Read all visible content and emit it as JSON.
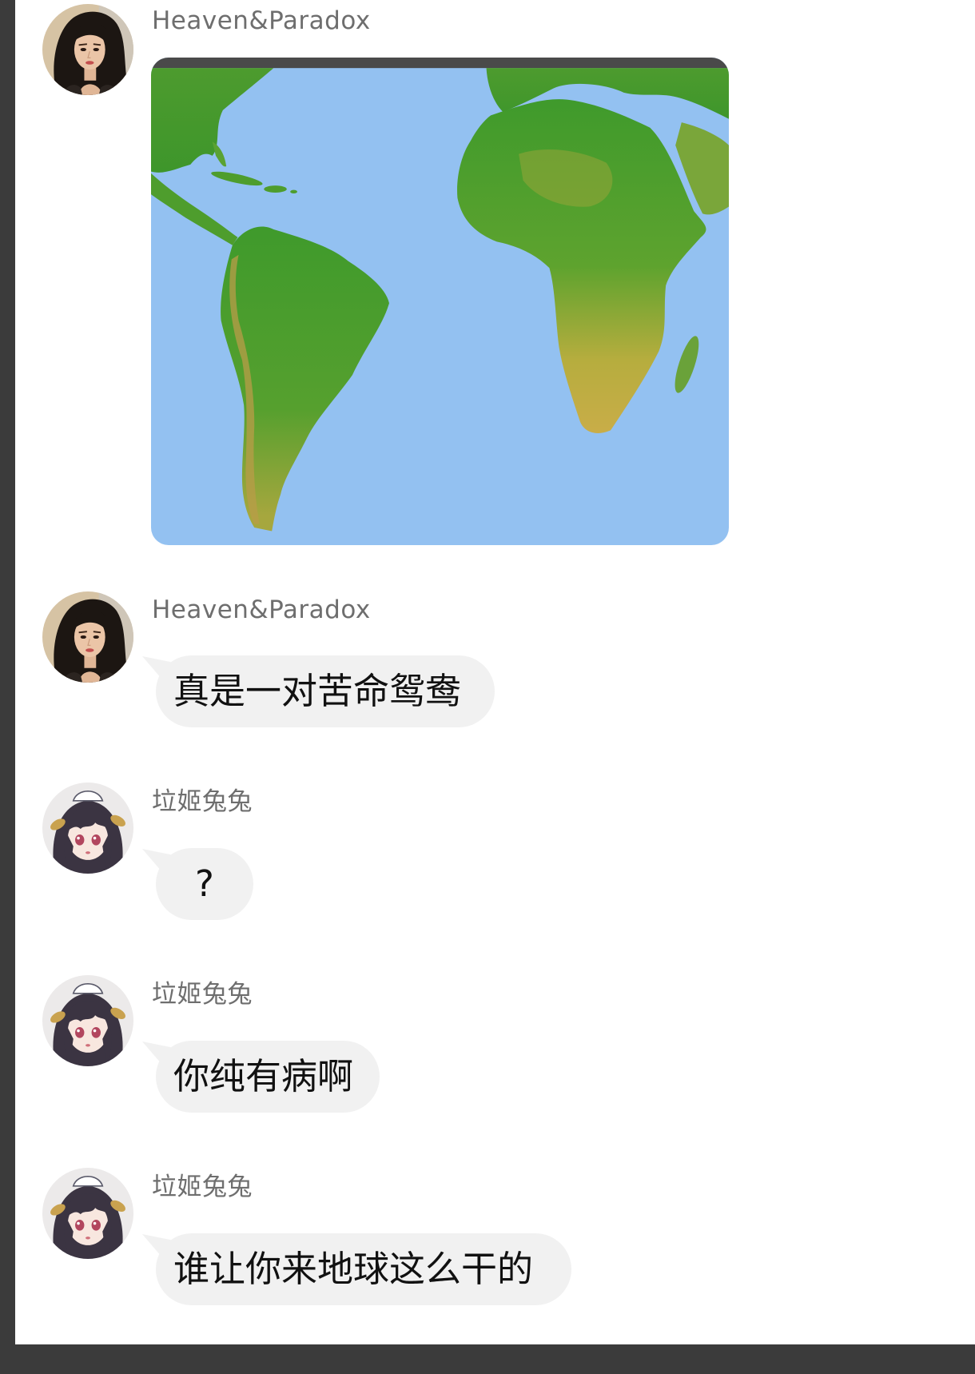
{
  "theme": {
    "frame_color": "#3b3b3b",
    "bubble_color": "#f1f1f1",
    "name_color": "#6e6e6e",
    "text_color": "#111111"
  },
  "messages": [
    {
      "sender": "Heaven&Paradox",
      "avatar": "woman-portrait-avatar-icon"
    },
    {
      "sender": "Heaven&Paradox",
      "avatar": "woman-portrait-avatar-icon",
      "text": "真是一对苦命鸳鸯"
    },
    {
      "sender": "垃姬兔兔",
      "avatar": "anime-girl-avatar-icon",
      "text": "?"
    },
    {
      "sender": "垃姬兔兔",
      "avatar": "anime-girl-avatar-icon",
      "text": "你纯有病啊"
    },
    {
      "sender": "垃姬兔兔",
      "avatar": "anime-girl-avatar-icon",
      "text": "谁让你来地球这么干的"
    }
  ]
}
